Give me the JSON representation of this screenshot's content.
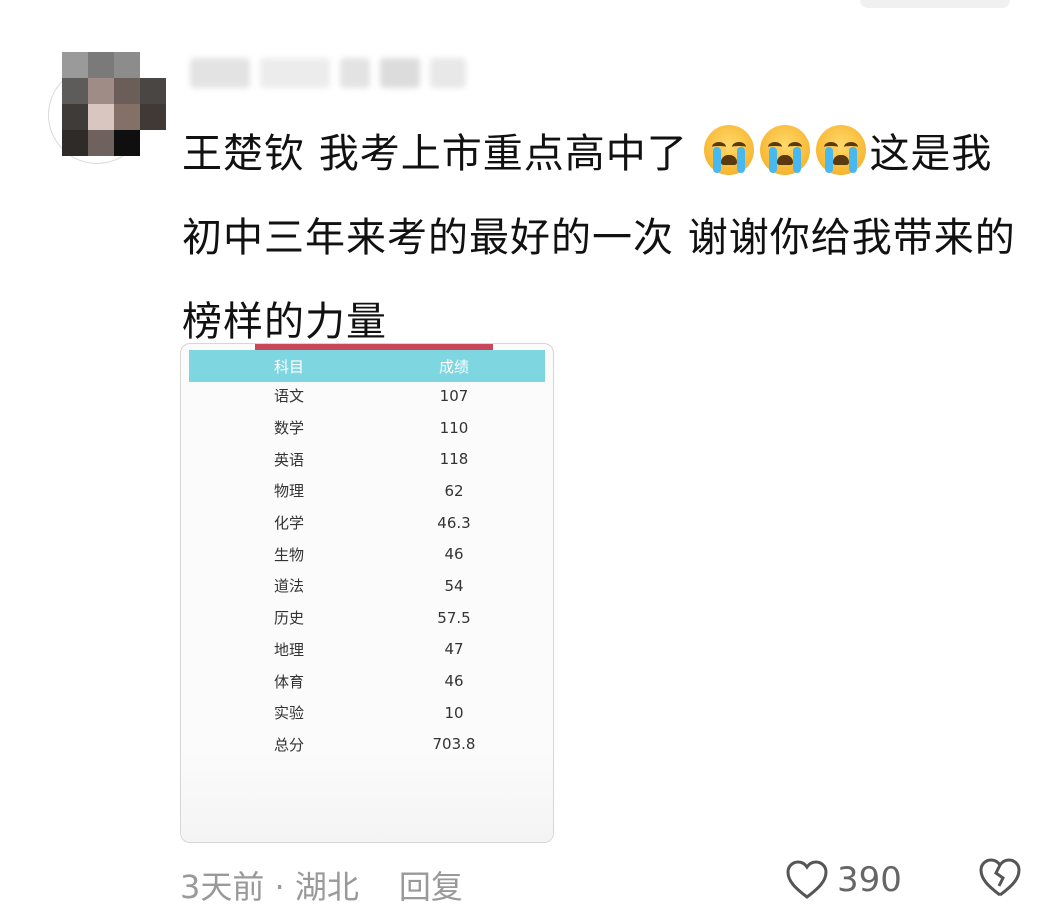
{
  "comment": {
    "text_part1": "王楚钦 我考上市重点高中了",
    "emoji_count": 3,
    "emoji": "loudly-crying-face",
    "text_part2": "这是我初中三年来考的最好的一次 谢谢你给我带来的榜样的力量"
  },
  "score_table": {
    "header_subject": "科目",
    "header_score": "成绩",
    "rows": [
      {
        "subject": "语文",
        "score": "107"
      },
      {
        "subject": "数学",
        "score": "110"
      },
      {
        "subject": "英语",
        "score": "118"
      },
      {
        "subject": "物理",
        "score": "62"
      },
      {
        "subject": "化学",
        "score": "46.3"
      },
      {
        "subject": "生物",
        "score": "46"
      },
      {
        "subject": "道法",
        "score": "54"
      },
      {
        "subject": "历史",
        "score": "57.5"
      },
      {
        "subject": "地理",
        "score": "47"
      },
      {
        "subject": "体育",
        "score": "46"
      },
      {
        "subject": "实验",
        "score": "10"
      },
      {
        "subject": "总分",
        "score": "703.8"
      }
    ]
  },
  "footer": {
    "meta": "3天前 · 湖北",
    "reply_label": "回复",
    "like_count": "390"
  },
  "colors": {
    "header_bg": "#7ed6e0",
    "accent_bar": "#c8475a"
  }
}
